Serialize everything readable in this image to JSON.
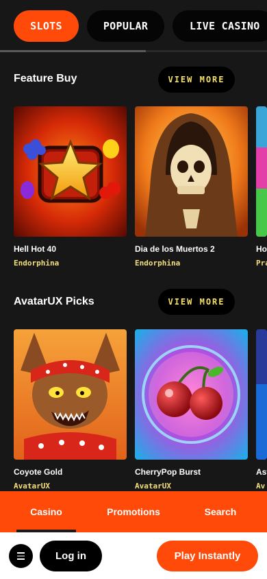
{
  "tabs": [
    {
      "label": "SLOTS",
      "active": true
    },
    {
      "label": "POPULAR",
      "active": false
    },
    {
      "label": "LIVE CASINO",
      "active": false
    }
  ],
  "sections": [
    {
      "title": "Feature Buy",
      "view_more": "VIEW MORE",
      "games": [
        {
          "name": "Hell Hot 40",
          "provider": "Endorphina"
        },
        {
          "name": "Dia de los Muertos 2",
          "provider": "Endorphina"
        },
        {
          "name": "Ho",
          "provider": "Pra"
        }
      ]
    },
    {
      "title": "AvatarUX Picks",
      "view_more": "VIEW MORE",
      "games": [
        {
          "name": "Coyote Gold",
          "provider": "AvatarUX"
        },
        {
          "name": "CherryPop Burst",
          "provider": "AvatarUX"
        },
        {
          "name": "Ast",
          "provider": "Av"
        }
      ]
    }
  ],
  "bottom_nav": {
    "items": [
      "Casino",
      "Promotions",
      "Search"
    ],
    "active": "Casino"
  },
  "footer": {
    "menu_icon": "hamburger-icon",
    "login_label": "Log in",
    "play_label": "Play Instantly"
  },
  "colors": {
    "accent": "#ff4a0a",
    "background": "#171717",
    "provider_text": "#f2e07b",
    "view_more_text": "#f5e06a"
  }
}
